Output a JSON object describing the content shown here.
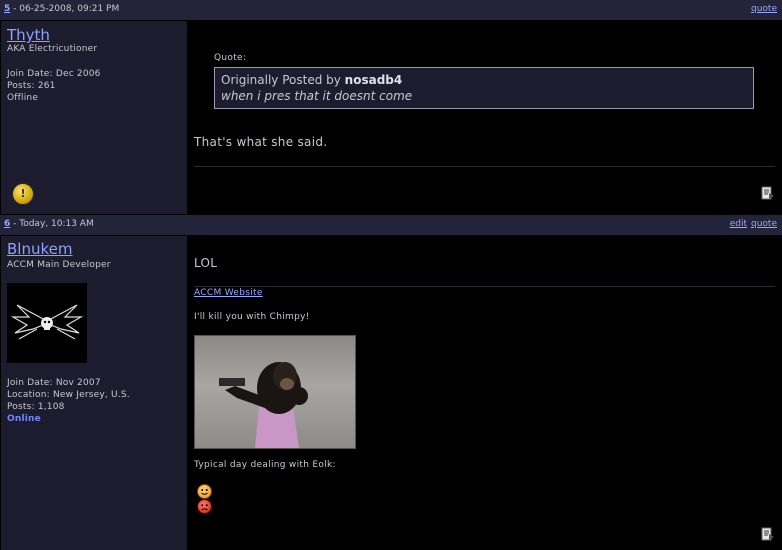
{
  "posts": [
    {
      "number": "5",
      "date": " - 06-25-2008, 09:21 PM",
      "actions": [
        "quote"
      ],
      "user": {
        "name": "Thyth",
        "title": "AKA Electricutioner",
        "info": [
          "Join Date: Dec 2006",
          "Posts: 261",
          "Offline"
        ],
        "status_icon": "warning-icon"
      },
      "quote_label": "Quote:",
      "quote_prefix": "Originally Posted by ",
      "quote_author": "nosadb4",
      "quote_text": "when i pres that it doesnt come",
      "message": "That's what she said."
    },
    {
      "number": "6",
      "date": " - Today, 10:13 AM",
      "actions": [
        "edit",
        "quote"
      ],
      "user": {
        "name": "Blnukem",
        "title": "ACCM Main Developer",
        "info": [
          "Join Date: Nov 2007",
          "Location: New Jersey, U.S.",
          "Posts: 1,108"
        ],
        "status": "Online"
      },
      "message": "LOL",
      "sig_link": "ACCM Website",
      "sig_line1": "I'll kill you with Chimpy!",
      "sig_line2": "Typical day dealing with Eolk:"
    }
  ],
  "colors": {
    "link": "#9aa7ff",
    "header": "#23233a",
    "sidebar": "#1c1c2e",
    "online": "#6f86ff"
  }
}
